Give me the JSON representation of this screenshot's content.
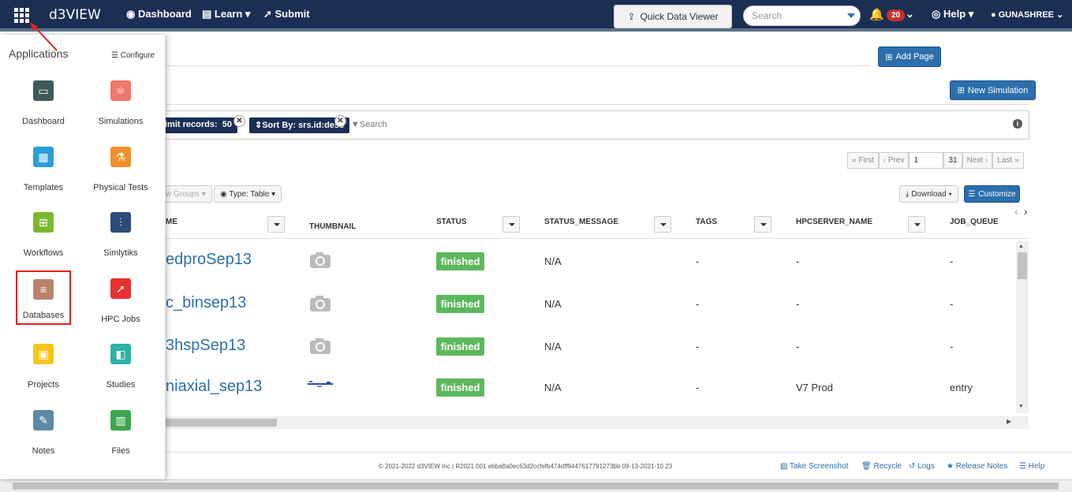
{
  "topbar": {
    "logo": "d3VIEW",
    "nav": [
      "Dashboard",
      "Learn",
      "Submit"
    ],
    "quick_data_viewer": "Quick Data Viewer",
    "search_placeholder": "Search",
    "notifications": "20",
    "help": "Help",
    "user": "Gunashree"
  },
  "sidebar": {
    "title": "Applications",
    "configure": "Configure",
    "apps": [
      {
        "label": "Dashboard",
        "color": "#3d5a5a"
      },
      {
        "label": "Simulations",
        "color": "#f0786a"
      },
      {
        "label": "Templates",
        "color": "#2a9fd8"
      },
      {
        "label": "Physical Tests",
        "color": "#f0912c"
      },
      {
        "label": "Workflows",
        "color": "#7cb82f"
      },
      {
        "label": "Simlytiks",
        "color": "#2d4a7a"
      },
      {
        "label": "Databases",
        "color": "#b9836a"
      },
      {
        "label": "HPC Jobs",
        "color": "#e8312f"
      },
      {
        "label": "Projects",
        "color": "#f5c518"
      },
      {
        "label": "Studies",
        "color": "#2bb3a7"
      },
      {
        "label": "Notes",
        "color": "#5c8aa8"
      },
      {
        "label": "Files",
        "color": "#3aa84a"
      }
    ]
  },
  "main": {
    "add_page": "Add Page",
    "new_simulation": "New Simulation",
    "filters": {
      "limit_label": "imit records:",
      "limit_value": "50",
      "sort_label": "Sort By: srs.id:desc",
      "search": "Search"
    },
    "pager": {
      "first": "First",
      "prev": "Prev",
      "page": "1",
      "total": "31",
      "next": "Next",
      "last": "Last"
    },
    "toolbar": {
      "groups": "w Groups",
      "type": "Type: Table",
      "download": "Download",
      "customize": "Customize"
    },
    "columns": [
      "ME",
      "THUMBNAIL",
      "STATUS",
      "STATUS_MESSAGE",
      "TAGS",
      "HPCSERVER_NAME",
      "JOB_QUEUE"
    ],
    "rows": [
      {
        "name": "edproSep13",
        "status": "finished",
        "message": "N/A",
        "tags": "-",
        "server": "-",
        "queue": "-"
      },
      {
        "name": "c_binsep13",
        "status": "finished",
        "message": "N/A",
        "tags": "-",
        "server": "-",
        "queue": "-"
      },
      {
        "name": "3hspSep13",
        "status": "finished",
        "message": "N/A",
        "tags": "-",
        "server": "-",
        "queue": "-"
      },
      {
        "name": "niaxial_sep13",
        "status": "finished",
        "message": "N/A",
        "tags": "-",
        "server": "V7 Prod",
        "queue": "entry"
      }
    ]
  },
  "footer": {
    "copyright": "© 2021-2022 d3VIEW Inc | R2021.001 ebba8a0ec63d2ccfefb474dff9447617791273bb 09-13-2021-10 23",
    "links": [
      "Take Screenshot",
      "Recycle",
      "Logs",
      "Release Notes",
      "Help"
    ]
  }
}
